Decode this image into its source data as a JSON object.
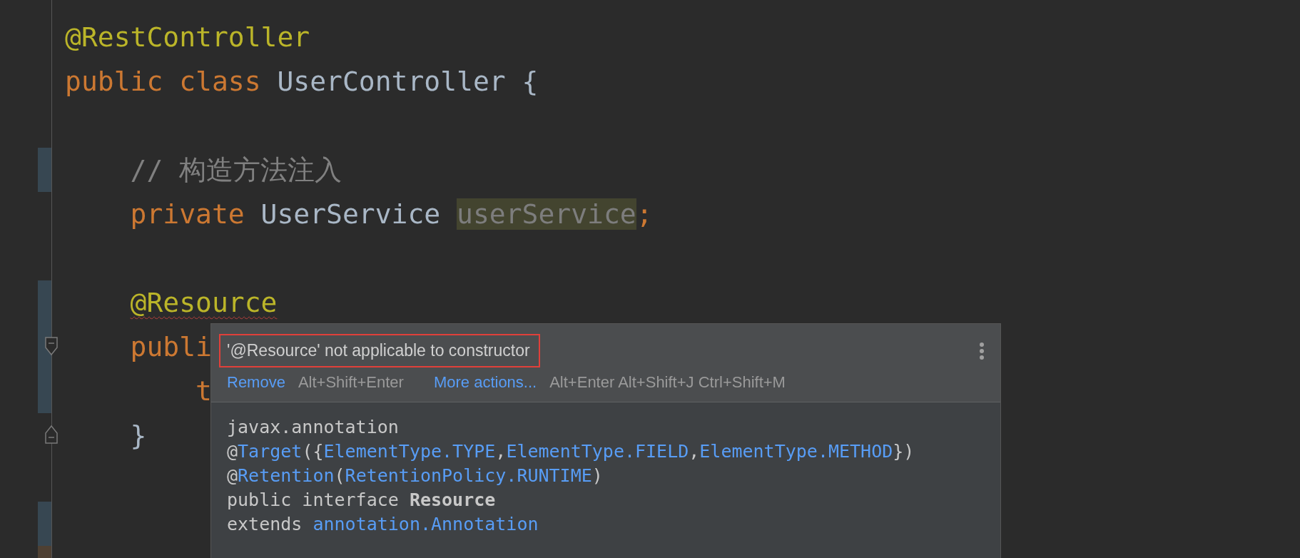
{
  "editor": {
    "lines": [
      {
        "kind": "top",
        "tokens": [
          {
            "kind": "annotation",
            "text": "@RestController"
          }
        ]
      },
      {
        "kind": "top",
        "tokens": [
          {
            "kind": "keyword",
            "text": "public class "
          },
          {
            "kind": "plain",
            "text": "UserController {"
          }
        ]
      },
      {
        "kind": "blank"
      },
      {
        "kind": "member",
        "marker": {
          "color": "#374752"
        },
        "tokens": [
          {
            "kind": "comment",
            "text": "// 构造方法注入"
          }
        ]
      },
      {
        "kind": "member",
        "tokens": [
          {
            "kind": "keyword",
            "text": "private "
          },
          {
            "kind": "plain",
            "text": "UserService "
          },
          {
            "kind": "unused",
            "text": "userService"
          },
          {
            "kind": "keyword",
            "text": ";"
          }
        ]
      },
      {
        "kind": "blank"
      },
      {
        "kind": "member",
        "marker": {
          "color": "#374752"
        },
        "tokens": [
          {
            "kind": "error",
            "text": "@Resource"
          }
        ]
      },
      {
        "kind": "member",
        "marker": {
          "color": "#374752"
        },
        "fold": {
          "kind": "start"
        },
        "tokens": [
          {
            "kind": "keyword",
            "text": "publi"
          }
        ]
      },
      {
        "kind": "body",
        "marker": {
          "color": "#374752"
        },
        "tokens": [
          {
            "kind": "keyword",
            "text": "t"
          }
        ]
      },
      {
        "kind": "member",
        "fold": {
          "kind": "end"
        },
        "tokens": [
          {
            "kind": "plain",
            "text": "}"
          }
        ]
      },
      {
        "kind": "blank"
      },
      {
        "kind": "blank",
        "marker": {
          "color": "#374752"
        }
      },
      {
        "kind": "blank",
        "marker": {
          "color": "#4e4033"
        }
      }
    ]
  },
  "popup": {
    "message": "'@Resource' not applicable to constructor",
    "actions": [
      {
        "kind": "link",
        "text": "Remove"
      },
      {
        "kind": "shortcut",
        "text": "Alt+Shift+Enter"
      },
      {
        "kind": "link",
        "text": "More actions..."
      },
      {
        "kind": "shortcut",
        "text": "Alt+Enter Alt+Shift+J Ctrl+Shift+M"
      }
    ],
    "doc": [
      [
        {
          "kind": "plain",
          "text": "javax.annotation"
        }
      ],
      [
        {
          "kind": "plain",
          "text": "@"
        },
        {
          "kind": "link",
          "text": "Target"
        },
        {
          "kind": "plain",
          "text": "({"
        },
        {
          "kind": "link",
          "text": "ElementType.TYPE"
        },
        {
          "kind": "plain",
          "text": ","
        },
        {
          "kind": "link",
          "text": "ElementType.FIELD"
        },
        {
          "kind": "plain",
          "text": ","
        },
        {
          "kind": "link",
          "text": "ElementType.METHOD"
        },
        {
          "kind": "plain",
          "text": "})"
        }
      ],
      [
        {
          "kind": "plain",
          "text": "@"
        },
        {
          "kind": "link",
          "text": "Retention"
        },
        {
          "kind": "plain",
          "text": "("
        },
        {
          "kind": "link",
          "text": "RetentionPolicy.RUNTIME"
        },
        {
          "kind": "plain",
          "text": ")"
        }
      ],
      [
        {
          "kind": "plain",
          "text": "public interface "
        },
        {
          "kind": "bold",
          "text": "Resource"
        }
      ],
      [
        {
          "kind": "plain",
          "text": "extends "
        },
        {
          "kind": "link",
          "text": "annotation.Annotation"
        }
      ]
    ]
  }
}
